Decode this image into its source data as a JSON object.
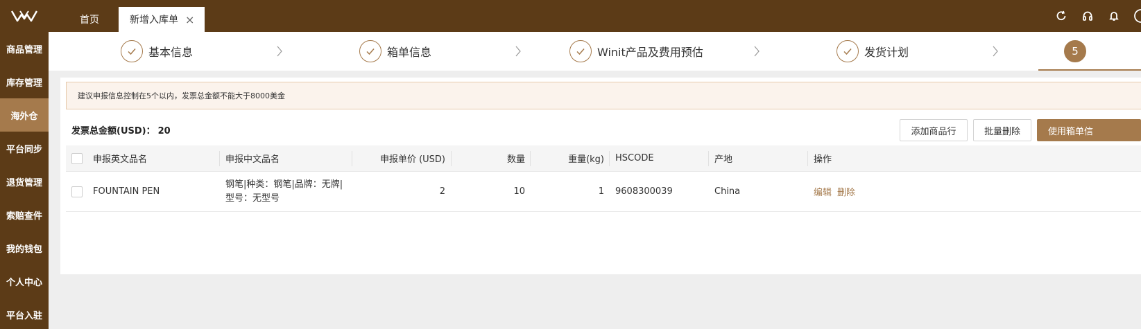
{
  "topbar": {
    "tabs": [
      {
        "label": "首页"
      },
      {
        "label": "新增入库单",
        "close": "×"
      }
    ],
    "icons": [
      "refresh-icon",
      "headset-icon",
      "bell-icon"
    ]
  },
  "sidebar": {
    "items": [
      {
        "label": "商品管理"
      },
      {
        "label": "库存管理"
      },
      {
        "label": "海外仓"
      },
      {
        "label": "平台同步"
      },
      {
        "label": "退货管理"
      },
      {
        "label": "索赔查件"
      },
      {
        "label": "我的钱包"
      },
      {
        "label": "个人中心"
      },
      {
        "label": "平台入驻"
      }
    ]
  },
  "steps": [
    {
      "label": "基本信息",
      "status": "done"
    },
    {
      "label": "箱单信息",
      "status": "done"
    },
    {
      "label": "Winit产品及费用预估",
      "status": "done"
    },
    {
      "label": "发货计划",
      "status": "done"
    },
    {
      "number": "5",
      "status": "current"
    }
  ],
  "alert": {
    "text": "建议申报信息控制在5个以内，发票总金额不能大于8000美金"
  },
  "total": {
    "label": "发票总金额(USD)：",
    "value": "20"
  },
  "actions": {
    "add_row": "添加商品行",
    "batch_delete": "批量删除",
    "use_packing": "使用箱单信"
  },
  "table": {
    "headers": [
      "申报英文品名",
      "申报中文品名",
      "申报单价 (USD)",
      "数量",
      "重量(kg)",
      "HSCODE",
      "产地",
      "操作"
    ],
    "rows": [
      {
        "en_name": "FOUNTAIN PEN",
        "cn_name": "钢笔|种类：钢笔|品牌：无牌|型号：无型号",
        "price": "2",
        "qty": "10",
        "weight": "1",
        "hscode": "9608300039",
        "origin": "China",
        "edit": "编辑",
        "delete": "删除"
      }
    ]
  },
  "colors": {
    "brown": "#5c3b17",
    "accent": "#a57a4c",
    "alert_bg": "#fbf3ec"
  }
}
